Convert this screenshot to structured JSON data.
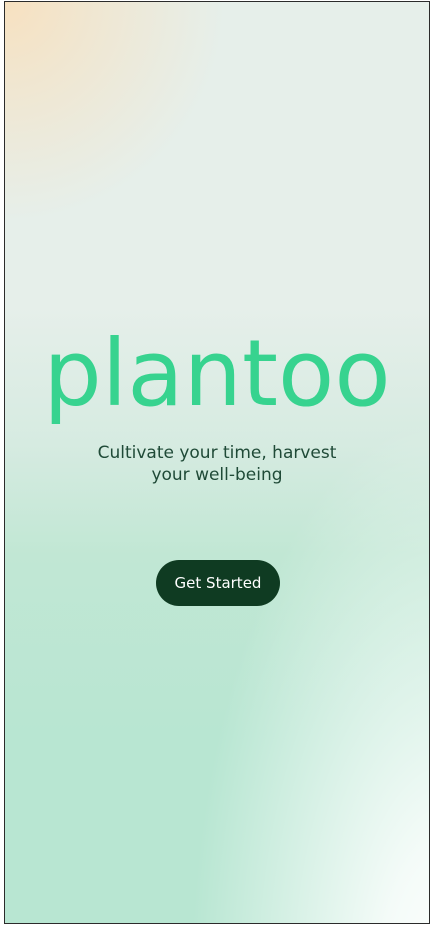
{
  "app": {
    "logo_text": "plantoo",
    "tagline_line1": "Cultivate your time, harvest",
    "tagline_line2": "your well-being"
  },
  "actions": {
    "get_started_label": "Get Started"
  },
  "colors": {
    "brand_green": "#37d38f",
    "button_bg": "#0f3b22",
    "text_dark": "#1f4a37"
  }
}
